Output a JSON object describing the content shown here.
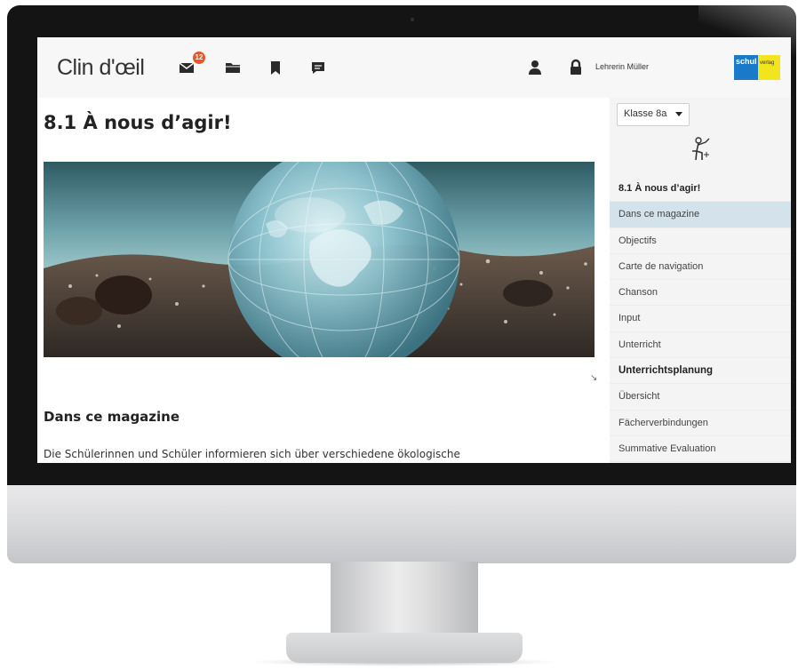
{
  "app": {
    "logo": "Clin d'œil",
    "mail_badge": "12",
    "user_name": "Lehrerin Müller",
    "brand": {
      "left": "schul",
      "right": "verlag"
    }
  },
  "main": {
    "title": "8.1 À nous d’agir!",
    "hero_alt": "",
    "section_heading": "Dans ce magazine",
    "body_text": "Die Schülerinnen und Schüler informieren sich über verschiedene ökologische"
  },
  "sidebar": {
    "class_select": "Klasse 8a",
    "items": [
      {
        "label": "8.1 À nous d’agir!",
        "style": "bold"
      },
      {
        "label": "Dans ce magazine",
        "style": "active"
      },
      {
        "label": "Objectifs",
        "style": "normal"
      },
      {
        "label": "Carte de navigation",
        "style": "normal"
      },
      {
        "label": "Chanson",
        "style": "normal"
      },
      {
        "label": "Input",
        "style": "normal"
      },
      {
        "label": "Unterricht",
        "style": "normal"
      },
      {
        "label": "Unterrichtsplanung",
        "style": "section"
      },
      {
        "label": "Übersicht",
        "style": "normal"
      },
      {
        "label": "Fächerverbindungen",
        "style": "normal"
      },
      {
        "label": "Summative Evaluation",
        "style": "normal"
      }
    ]
  },
  "icons": {
    "mail": "mail-icon",
    "folder": "folder-icon",
    "bookmark": "bookmark-icon",
    "chat": "chat-icon",
    "user": "user-icon",
    "lock": "lock-icon",
    "teacher": "teacher-board-icon"
  },
  "colors": {
    "active_nav": "#d4e2ec",
    "badge": "#e8552a",
    "brand_blue": "#1a79c8",
    "brand_yellow": "#f2e51d"
  }
}
